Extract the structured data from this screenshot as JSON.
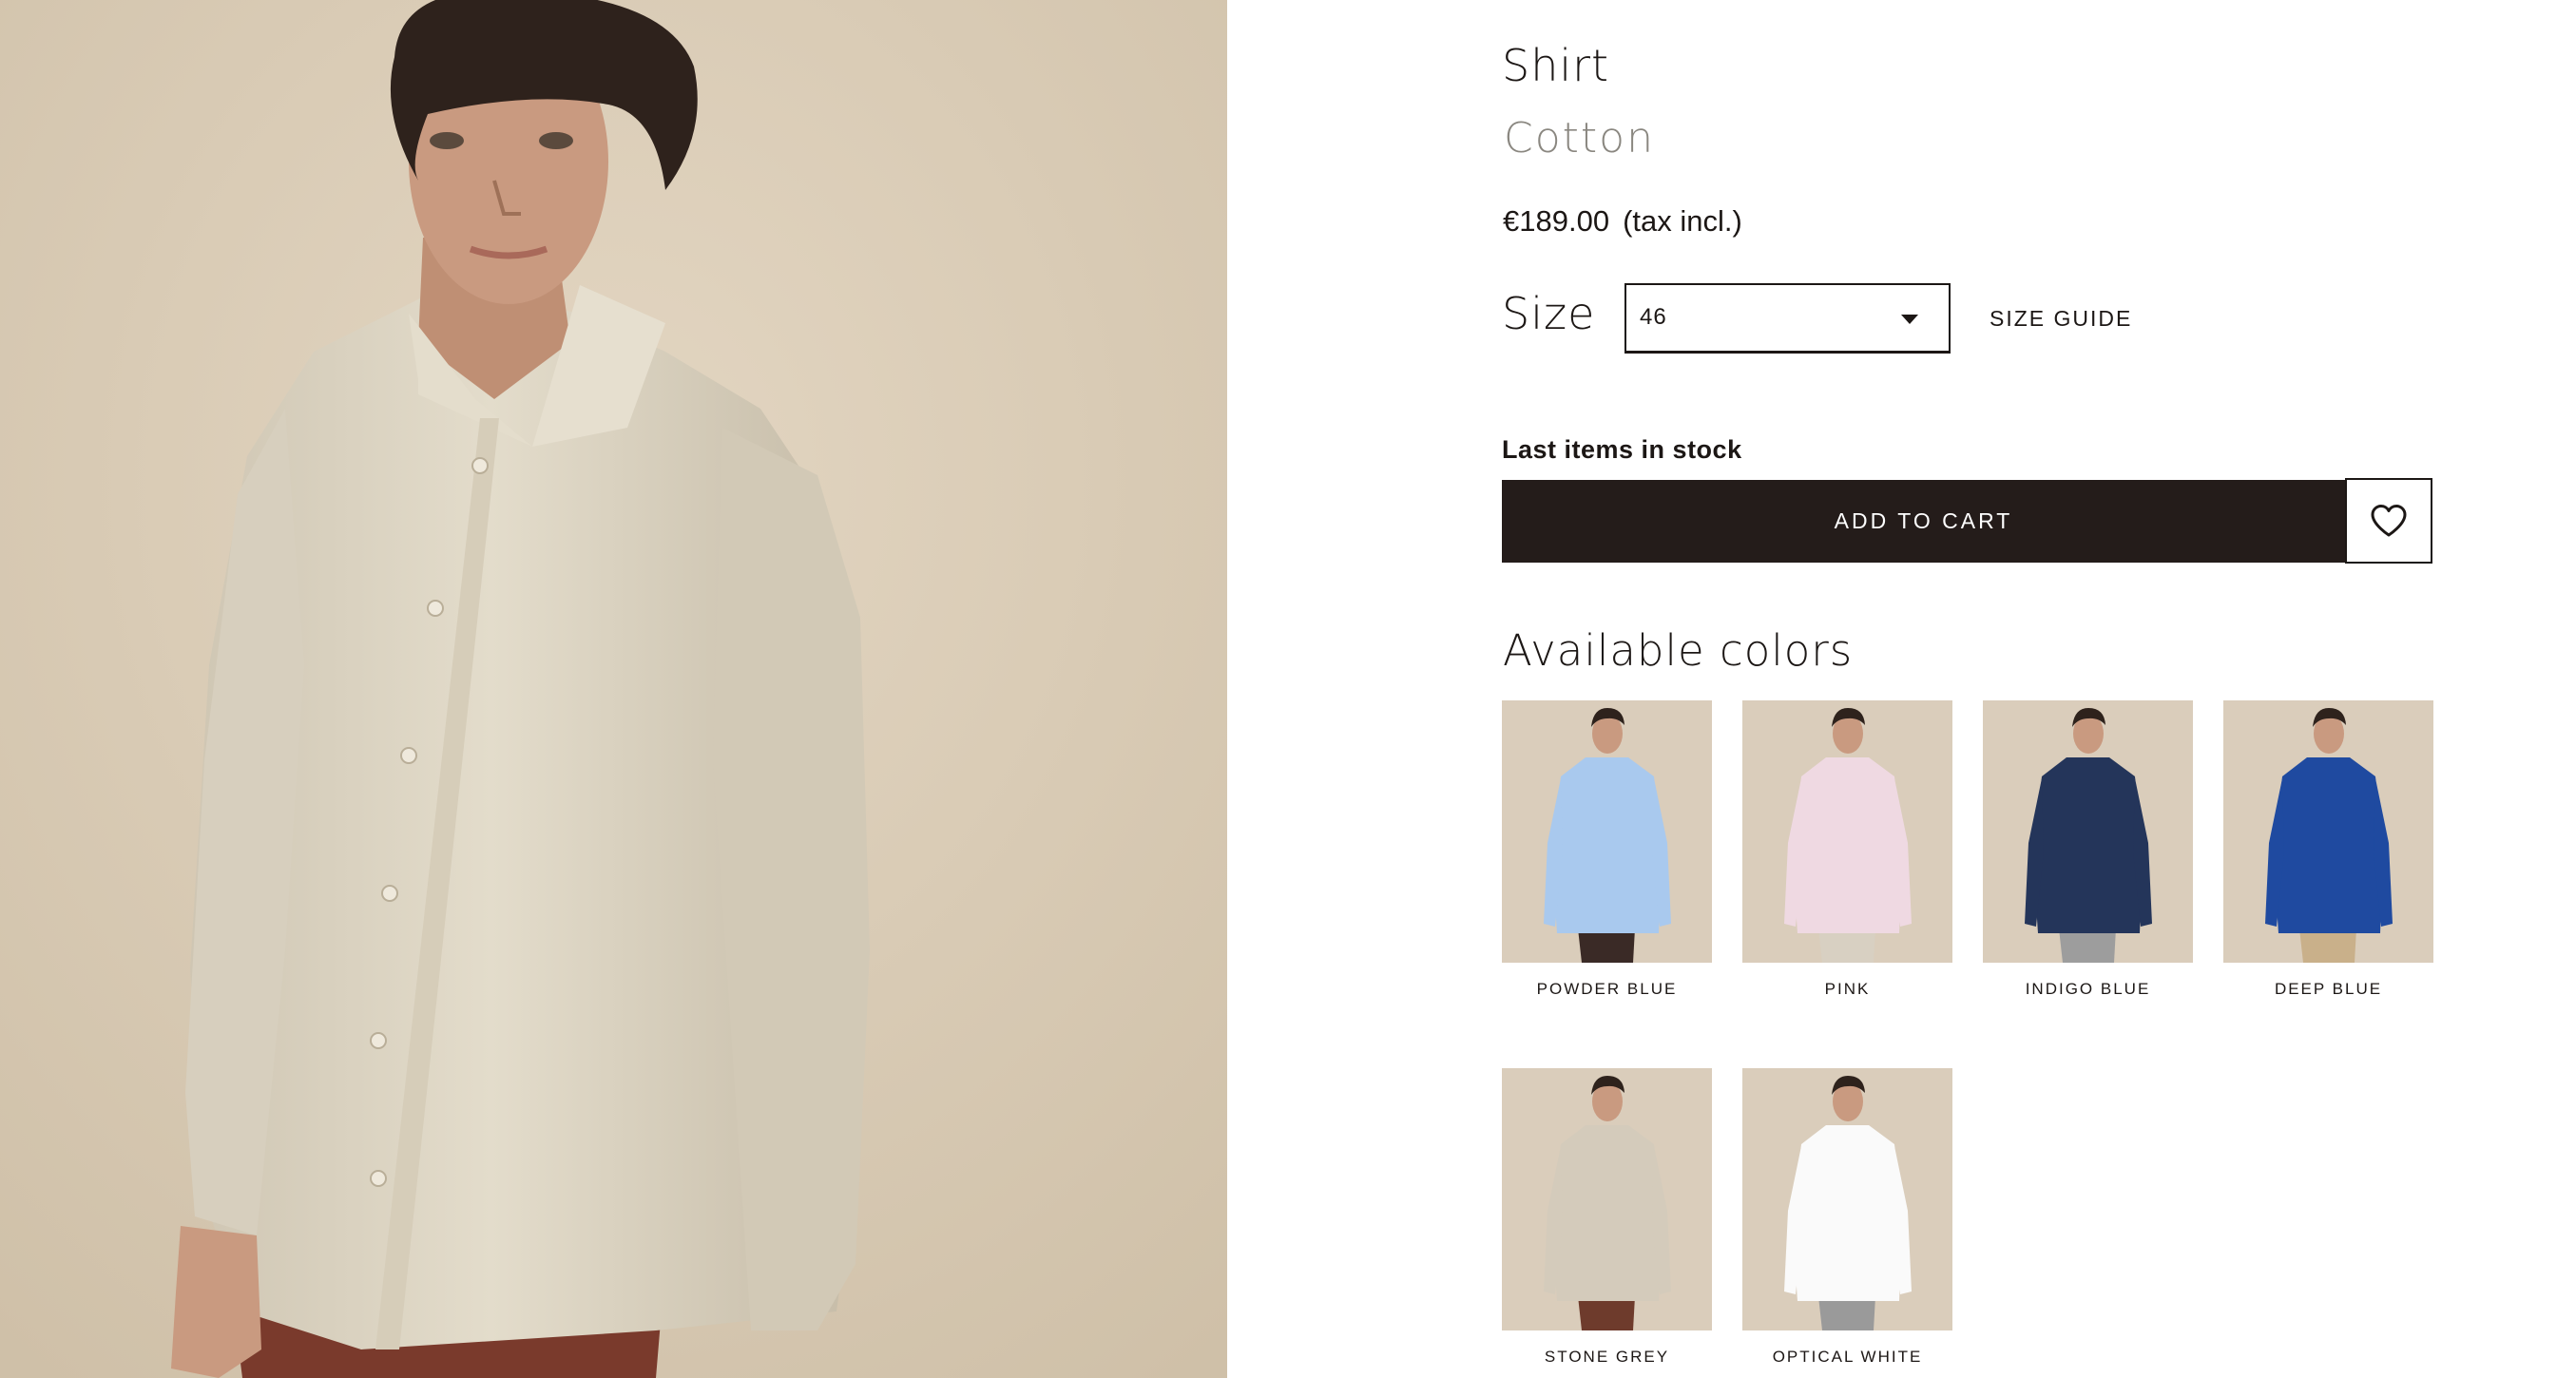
{
  "product": {
    "title": "Shirt",
    "material": "Cotton",
    "price": "€189.00",
    "tax_note": "(tax incl.)"
  },
  "size": {
    "label": "Size",
    "selected": "46",
    "guide_label": "SIZE GUIDE"
  },
  "stock_status": "Last items in stock",
  "add_to_cart_label": "ADD TO CART",
  "wishlist_icon": "heart-icon",
  "colors": {
    "heading": "Available colors",
    "items": [
      {
        "name": "POWDER BLUE",
        "shirt": "#a9c9ee",
        "pants": "#3a2a26"
      },
      {
        "name": "PINK",
        "shirt": "#efd9e2",
        "pants": "#d8d0c2"
      },
      {
        "name": "INDIGO BLUE",
        "shirt": "#24355a",
        "pants": "#9d9d9d"
      },
      {
        "name": "DEEP BLUE",
        "shirt": "#1f4aa0",
        "pants": "#c9b08a"
      },
      {
        "name": "STONE GREY",
        "shirt": "#d4cbbb",
        "pants": "#6e3b2c"
      },
      {
        "name": "OPTICAL WHITE",
        "shirt": "#fafafa",
        "pants": "#9a9a9a"
      }
    ]
  },
  "hero_colors": {
    "background": "#d8cbb6",
    "shirt": "#ddd5c4",
    "skin": "#c99a80",
    "hair": "#2e221c",
    "pants": "#7a3a2c"
  }
}
